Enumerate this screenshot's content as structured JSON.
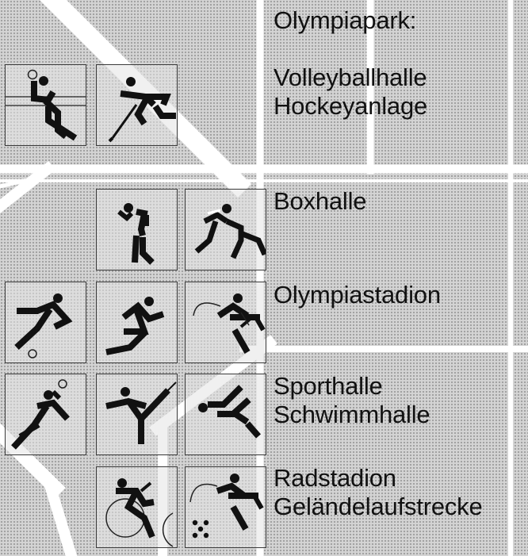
{
  "colors": {
    "background_grey": "#c9c9c9",
    "map_lines": "#ffffff",
    "pictogram": "#111111",
    "text": "#111111"
  },
  "header": {
    "title": "Olympiapark:"
  },
  "groups": [
    {
      "lines": [
        "Volleyballhalle",
        "Hockeyanlage"
      ],
      "icons": [
        "volleyball-pictogram",
        "hockey-pictogram"
      ]
    },
    {
      "lines": [
        "Boxhalle"
      ],
      "icons": [
        "boxing-pictogram",
        "wrestling-pictogram"
      ]
    },
    {
      "lines": [
        "Olympiastadion"
      ],
      "icons": [
        "football-pictogram",
        "athletics-running-pictogram",
        "equestrian-pictogram"
      ]
    },
    {
      "lines": [
        "Sporthalle",
        "Schwimmhalle"
      ],
      "icons": [
        "handball-pictogram",
        "gymnastics-pictogram",
        "swimming-pictogram"
      ]
    },
    {
      "lines": [
        "Radstadion",
        "Geländelaufstrecke"
      ],
      "icons": [
        "cycling-pictogram",
        "modern-pentathlon-pictogram"
      ]
    }
  ]
}
